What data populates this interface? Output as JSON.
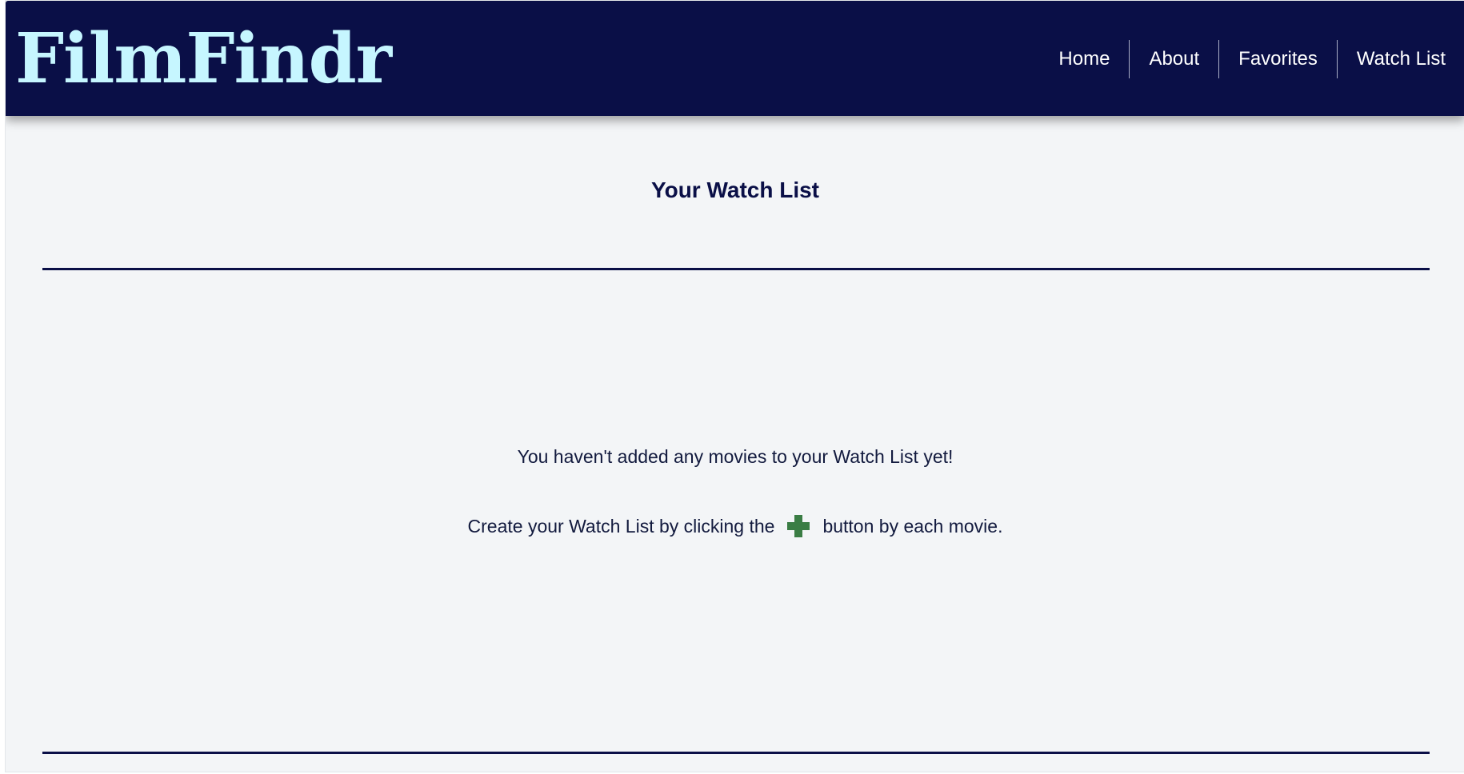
{
  "header": {
    "logo": "FilmFindr",
    "nav": [
      {
        "label": "Home"
      },
      {
        "label": "About"
      },
      {
        "label": "Favorites"
      },
      {
        "label": "Watch List"
      }
    ]
  },
  "main": {
    "title": "Your Watch List",
    "empty_message": "You haven't added any movies to your Watch List yet!",
    "instruction_prefix": "Create your Watch List by clicking the",
    "instruction_icon": "plus-icon",
    "instruction_suffix": "button by each movie."
  },
  "colors": {
    "navbar_bg": "#0a0f47",
    "logo": "#c6f6ff",
    "page_bg": "#f3f5f7",
    "plus_icon": "#3a7d44"
  }
}
